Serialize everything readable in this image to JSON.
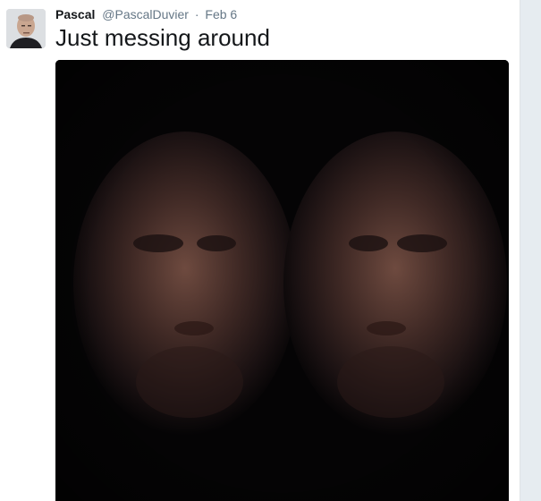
{
  "tweet": {
    "author_name": "Pascal",
    "author_handle": "@PascalDuvier",
    "separator": "·",
    "date": "Feb 6",
    "text": "Just messing around"
  },
  "icons": {
    "avatar": "profile-photo",
    "media": "mirrored-face-photo"
  },
  "colors": {
    "name": "#14171a",
    "meta": "#657786",
    "rail": "#e6ecf0",
    "media_background": "#050405"
  }
}
